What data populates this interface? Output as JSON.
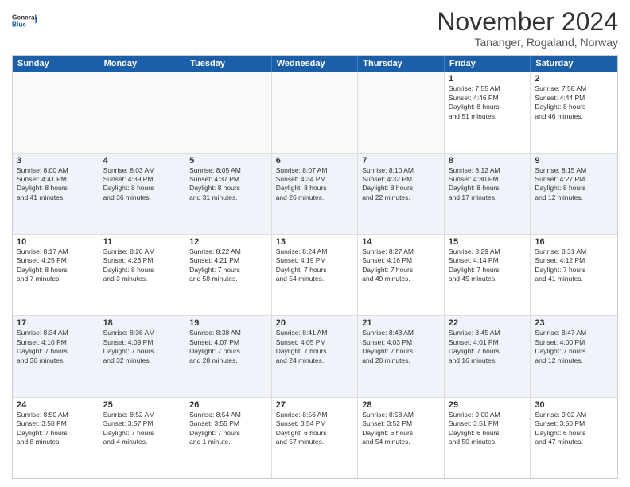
{
  "logo": {
    "general": "General",
    "blue": "Blue"
  },
  "title": "November 2024",
  "location": "Tananger, Rogaland, Norway",
  "weekdays": [
    "Sunday",
    "Monday",
    "Tuesday",
    "Wednesday",
    "Thursday",
    "Friday",
    "Saturday"
  ],
  "weeks": [
    [
      {
        "day": "",
        "info": ""
      },
      {
        "day": "",
        "info": ""
      },
      {
        "day": "",
        "info": ""
      },
      {
        "day": "",
        "info": ""
      },
      {
        "day": "",
        "info": ""
      },
      {
        "day": "1",
        "info": "Sunrise: 7:55 AM\nSunset: 4:46 PM\nDaylight: 8 hours\nand 51 minutes."
      },
      {
        "day": "2",
        "info": "Sunrise: 7:58 AM\nSunset: 4:44 PM\nDaylight: 8 hours\nand 46 minutes."
      }
    ],
    [
      {
        "day": "3",
        "info": "Sunrise: 8:00 AM\nSunset: 4:41 PM\nDaylight: 8 hours\nand 41 minutes."
      },
      {
        "day": "4",
        "info": "Sunrise: 8:03 AM\nSunset: 4:39 PM\nDaylight: 8 hours\nand 36 minutes."
      },
      {
        "day": "5",
        "info": "Sunrise: 8:05 AM\nSunset: 4:37 PM\nDaylight: 8 hours\nand 31 minutes."
      },
      {
        "day": "6",
        "info": "Sunrise: 8:07 AM\nSunset: 4:34 PM\nDaylight: 8 hours\nand 26 minutes."
      },
      {
        "day": "7",
        "info": "Sunrise: 8:10 AM\nSunset: 4:32 PM\nDaylight: 8 hours\nand 22 minutes."
      },
      {
        "day": "8",
        "info": "Sunrise: 8:12 AM\nSunset: 4:30 PM\nDaylight: 8 hours\nand 17 minutes."
      },
      {
        "day": "9",
        "info": "Sunrise: 8:15 AM\nSunset: 4:27 PM\nDaylight: 8 hours\nand 12 minutes."
      }
    ],
    [
      {
        "day": "10",
        "info": "Sunrise: 8:17 AM\nSunset: 4:25 PM\nDaylight: 8 hours\nand 7 minutes."
      },
      {
        "day": "11",
        "info": "Sunrise: 8:20 AM\nSunset: 4:23 PM\nDaylight: 8 hours\nand 3 minutes."
      },
      {
        "day": "12",
        "info": "Sunrise: 8:22 AM\nSunset: 4:21 PM\nDaylight: 7 hours\nand 58 minutes."
      },
      {
        "day": "13",
        "info": "Sunrise: 8:24 AM\nSunset: 4:19 PM\nDaylight: 7 hours\nand 54 minutes."
      },
      {
        "day": "14",
        "info": "Sunrise: 8:27 AM\nSunset: 4:16 PM\nDaylight: 7 hours\nand 49 minutes."
      },
      {
        "day": "15",
        "info": "Sunrise: 8:29 AM\nSunset: 4:14 PM\nDaylight: 7 hours\nand 45 minutes."
      },
      {
        "day": "16",
        "info": "Sunrise: 8:31 AM\nSunset: 4:12 PM\nDaylight: 7 hours\nand 41 minutes."
      }
    ],
    [
      {
        "day": "17",
        "info": "Sunrise: 8:34 AM\nSunset: 4:10 PM\nDaylight: 7 hours\nand 36 minutes."
      },
      {
        "day": "18",
        "info": "Sunrise: 8:36 AM\nSunset: 4:09 PM\nDaylight: 7 hours\nand 32 minutes."
      },
      {
        "day": "19",
        "info": "Sunrise: 8:38 AM\nSunset: 4:07 PM\nDaylight: 7 hours\nand 28 minutes."
      },
      {
        "day": "20",
        "info": "Sunrise: 8:41 AM\nSunset: 4:05 PM\nDaylight: 7 hours\nand 24 minutes."
      },
      {
        "day": "21",
        "info": "Sunrise: 8:43 AM\nSunset: 4:03 PM\nDaylight: 7 hours\nand 20 minutes."
      },
      {
        "day": "22",
        "info": "Sunrise: 8:45 AM\nSunset: 4:01 PM\nDaylight: 7 hours\nand 16 minutes."
      },
      {
        "day": "23",
        "info": "Sunrise: 8:47 AM\nSunset: 4:00 PM\nDaylight: 7 hours\nand 12 minutes."
      }
    ],
    [
      {
        "day": "24",
        "info": "Sunrise: 8:50 AM\nSunset: 3:58 PM\nDaylight: 7 hours\nand 8 minutes."
      },
      {
        "day": "25",
        "info": "Sunrise: 8:52 AM\nSunset: 3:57 PM\nDaylight: 7 hours\nand 4 minutes."
      },
      {
        "day": "26",
        "info": "Sunrise: 8:54 AM\nSunset: 3:55 PM\nDaylight: 7 hours\nand 1 minute."
      },
      {
        "day": "27",
        "info": "Sunrise: 8:56 AM\nSunset: 3:54 PM\nDaylight: 6 hours\nand 57 minutes."
      },
      {
        "day": "28",
        "info": "Sunrise: 8:58 AM\nSunset: 3:52 PM\nDaylight: 6 hours\nand 54 minutes."
      },
      {
        "day": "29",
        "info": "Sunrise: 9:00 AM\nSunset: 3:51 PM\nDaylight: 6 hours\nand 50 minutes."
      },
      {
        "day": "30",
        "info": "Sunrise: 9:02 AM\nSunset: 3:50 PM\nDaylight: 6 hours\nand 47 minutes."
      }
    ]
  ]
}
